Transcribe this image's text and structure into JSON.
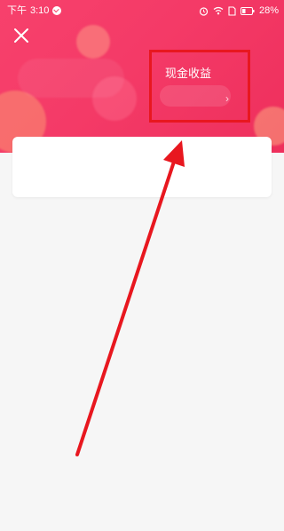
{
  "status_bar": {
    "time_prefix": "下午",
    "time": "3:10",
    "battery": "28%"
  },
  "header": {
    "close_icon": "close-icon"
  },
  "earnings": {
    "label": "现金收益",
    "chevron": "›"
  },
  "colors": {
    "hero_gradient_start": "#f7416c",
    "hero_gradient_end": "#ee2f5c",
    "highlight_border": "#e8171f",
    "annotation_arrow": "#e8171f",
    "page_background": "#f6f6f6",
    "card_background": "#ffffff"
  }
}
